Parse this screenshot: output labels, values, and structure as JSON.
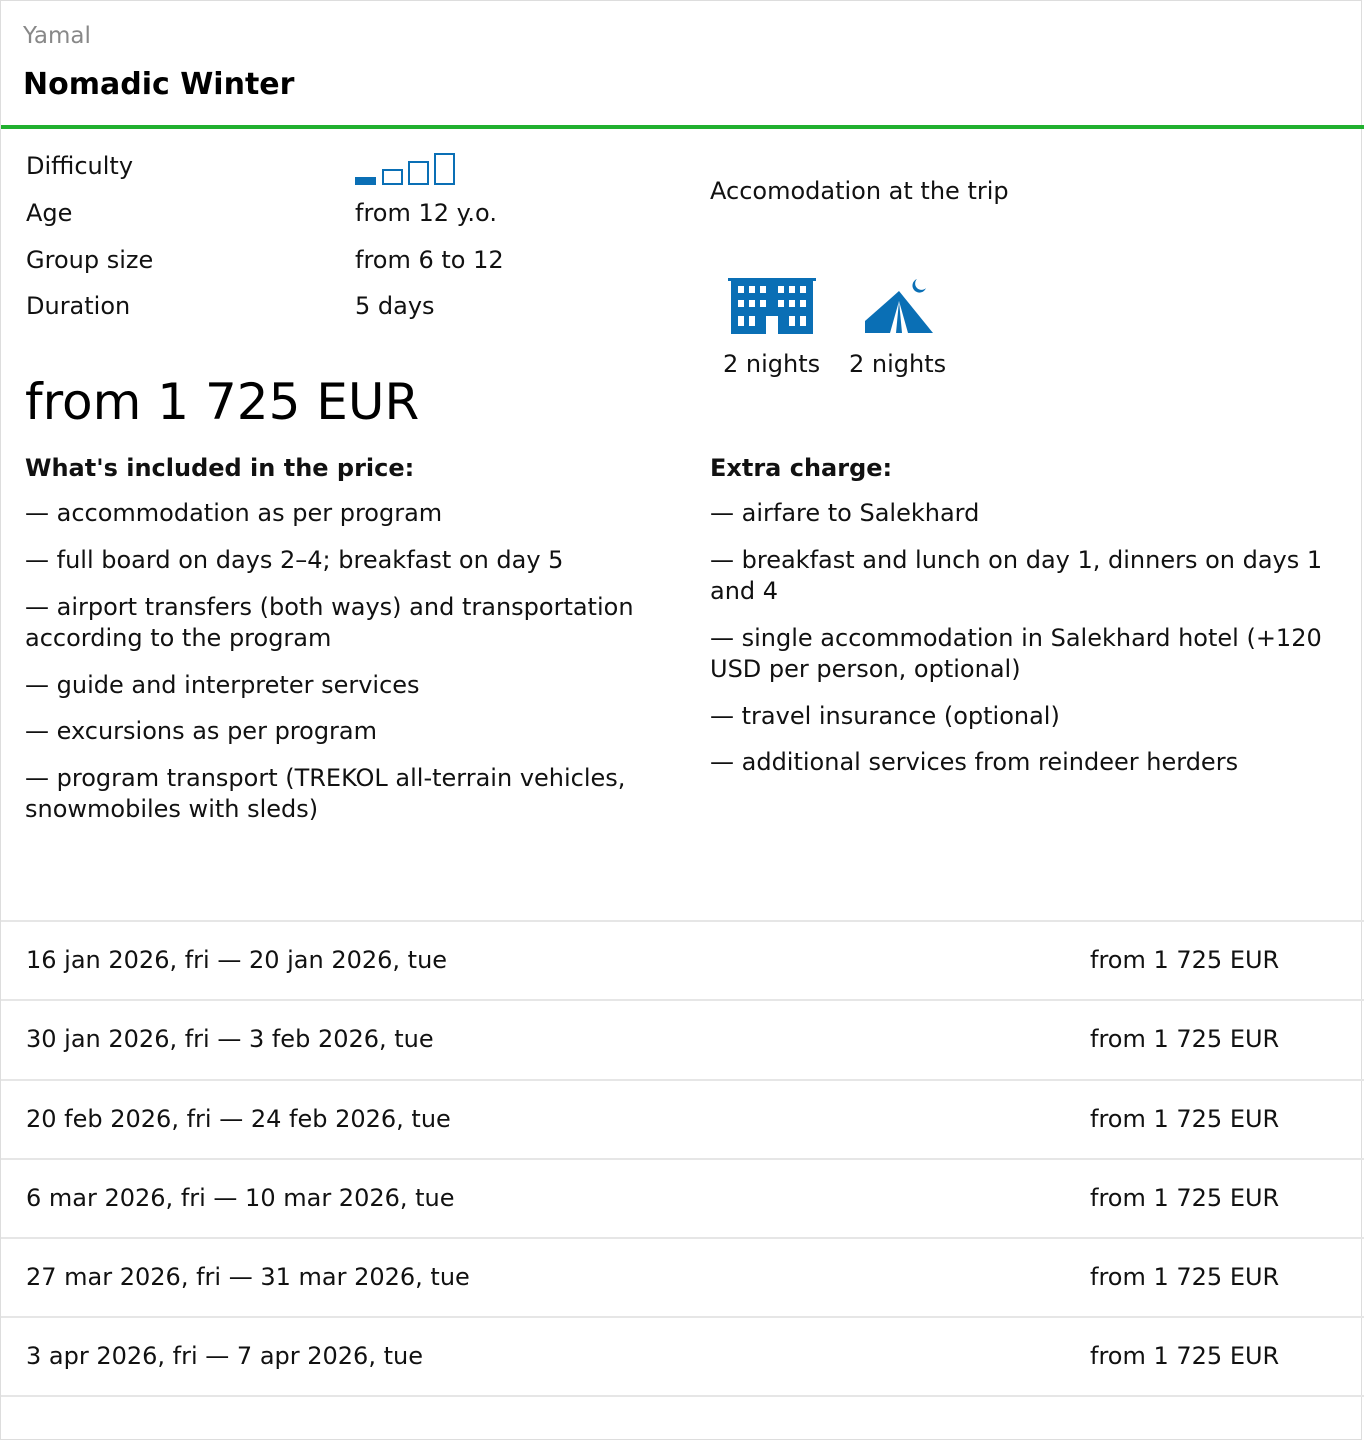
{
  "header": {
    "region": "Yamal",
    "title": "Nomadic Winter"
  },
  "specs": {
    "difficulty_label": "Difficulty",
    "difficulty_level": 1,
    "difficulty_max": 4,
    "age_label": "Age",
    "age_value": "from 12 y.o.",
    "group_label": "Group size",
    "group_value": "from 6 to 12",
    "duration_label": "Duration",
    "duration_value": "5 days"
  },
  "price": "from 1 725 EUR",
  "accommodation": {
    "title": "Accomodation at the trip",
    "items": [
      {
        "icon": "hotel-icon",
        "nights": "2 nights"
      },
      {
        "icon": "tent-icon",
        "nights": "2 nights"
      }
    ]
  },
  "included": {
    "title": "What's included in the price:",
    "items": [
      "— accommodation as per program",
      "— full board on days 2–4; breakfast on day 5",
      "— airport transfers (both ways) and transportation according to the program",
      "— guide and interpreter services",
      "— excursions as per program",
      "— program transport (TREKOL all-terrain vehicles, snowmobiles with sleds)"
    ]
  },
  "extra": {
    "title": "Extra charge:",
    "items": [
      "— airfare to Salekhard",
      "— breakfast and lunch on day 1, dinners on days 1 and 4",
      "— single accommodation in Salekhard hotel (+120 USD per person, optional)",
      "— travel insurance (optional)",
      "— additional services from reindeer herders"
    ]
  },
  "dates": [
    {
      "range": "16 jan 2026, fri — 20 jan 2026, tue",
      "price": "from 1 725 EUR"
    },
    {
      "range": "30 jan 2026, fri — 3 feb 2026, tue",
      "price": "from 1 725 EUR"
    },
    {
      "range": "20 feb 2026, fri — 24 feb 2026, tue",
      "price": "from 1 725 EUR"
    },
    {
      "range": "6 mar 2026, fri — 10 mar 2026, tue",
      "price": "from 1 725 EUR"
    },
    {
      "range": "27 mar 2026, fri — 31 mar 2026, tue",
      "price": "from 1 725 EUR"
    },
    {
      "range": "3 apr 2026, fri — 7 apr 2026, tue",
      "price": "from 1 725 EUR"
    }
  ],
  "colors": {
    "accent": "#0a6fb5",
    "rule": "#21b02f",
    "muted": "#888888"
  }
}
